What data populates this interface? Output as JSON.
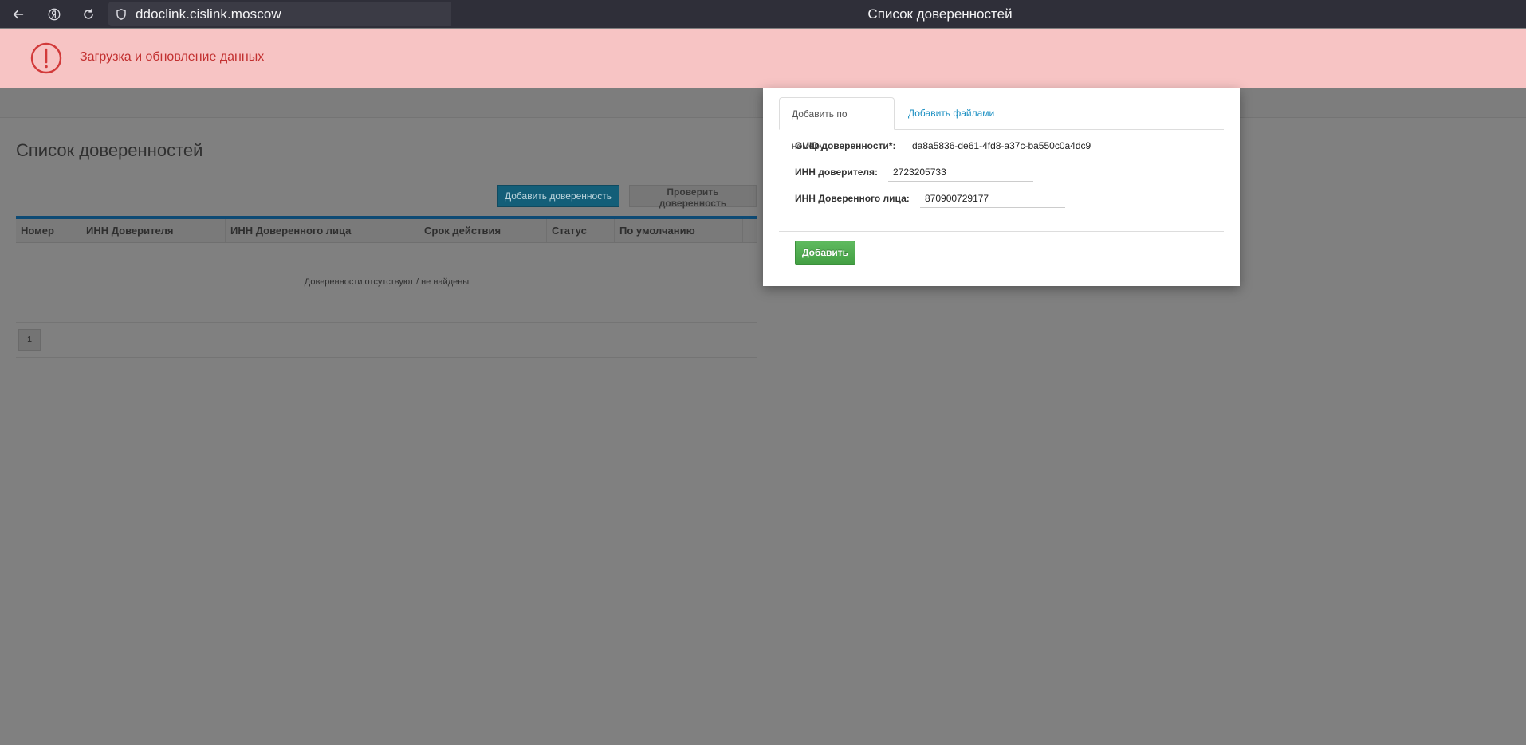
{
  "browser": {
    "url": "ddoclink.cislink.moscow",
    "tab_title": "Список доверенностей"
  },
  "notification": {
    "text": "Загрузка и обновление данных",
    "color": "#c22f2f"
  },
  "page": {
    "title": "Список доверенностей",
    "add_button": "Добавить доверенность",
    "check_button": "Проверить доверенность",
    "table": {
      "columns": [
        "Номер",
        "ИНН Доверителя",
        "ИНН Доверенного лица",
        "Срок действия",
        "Статус",
        "По умолчанию"
      ],
      "empty_message": "Доверенности отсутствуют / не найдены"
    },
    "pagination": {
      "current_page": "1"
    }
  },
  "modal": {
    "tabs": [
      {
        "label": "Добавить по номеру",
        "active": true
      },
      {
        "label": "Добавить файлами",
        "active": false
      }
    ],
    "fields": {
      "guid_label": "GUID доверенности*:",
      "guid_value": "da8a5836-de61-4fd8-a37c-ba550c0a4dc9",
      "inn_principal_label": "ИНН доверителя:",
      "inn_principal_value": "2723205733",
      "inn_agent_label": "ИНН Доверенного лица:",
      "inn_agent_value": "870900729177"
    },
    "submit_label": "Добавить"
  }
}
